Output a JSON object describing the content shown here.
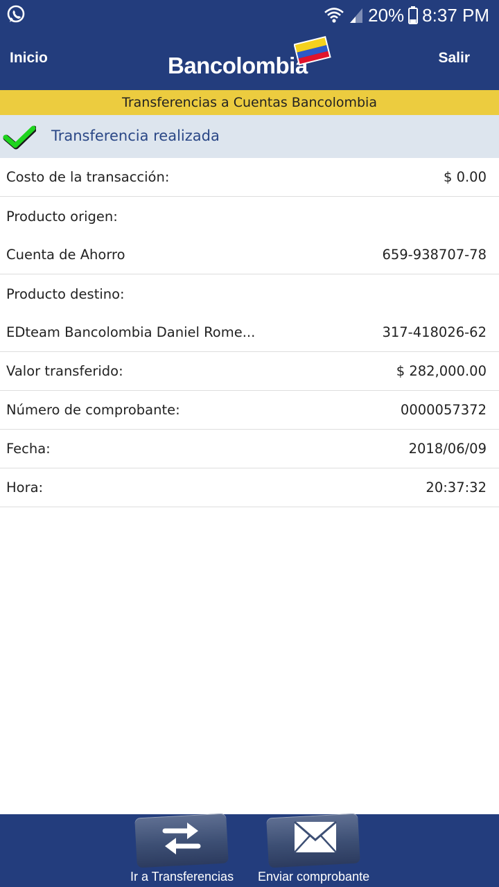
{
  "status_bar": {
    "left_icon": "whatsapp-icon",
    "battery_percent": "20%",
    "time": "8:37 PM",
    "icons": [
      "wifi-icon",
      "signal-icon",
      "battery-icon"
    ]
  },
  "header": {
    "left_link": "Inicio",
    "brand": "Bancolombia",
    "right_link": "Salir",
    "colors": {
      "bar": "#233d7d",
      "accent_yellow": "#eccc3f"
    }
  },
  "title_strip": {
    "text": "Transferencias a Cuentas Bancolombia"
  },
  "banner": {
    "icon": "check-icon",
    "text": "Transferencia realizada",
    "check_color": "#1ed41e"
  },
  "details": {
    "rows": [
      {
        "label": "Costo de la transacción:",
        "value": "$ 0.00"
      },
      {
        "label": "Producto origen:",
        "value": ""
      },
      {
        "label": "Cuenta de Ahorro",
        "value": "659-938707-78"
      },
      {
        "label": "Producto destino:",
        "value": ""
      },
      {
        "label": "EDteam Bancolombia Daniel Rome...",
        "value": "317-418026-62"
      },
      {
        "label": "Valor transferido:",
        "value": "$ 282,000.00"
      },
      {
        "label": "Número de comprobante:",
        "value": "0000057372"
      },
      {
        "label": "Fecha:",
        "value": "2018/06/09"
      },
      {
        "label": "Hora:",
        "value": "20:37:32"
      }
    ]
  },
  "bottom_nav": {
    "items": [
      {
        "label": "Ir a Transferencias",
        "icon": "transfer-arrows-icon"
      },
      {
        "label": "Enviar comprobante",
        "icon": "envelope-icon"
      }
    ]
  }
}
